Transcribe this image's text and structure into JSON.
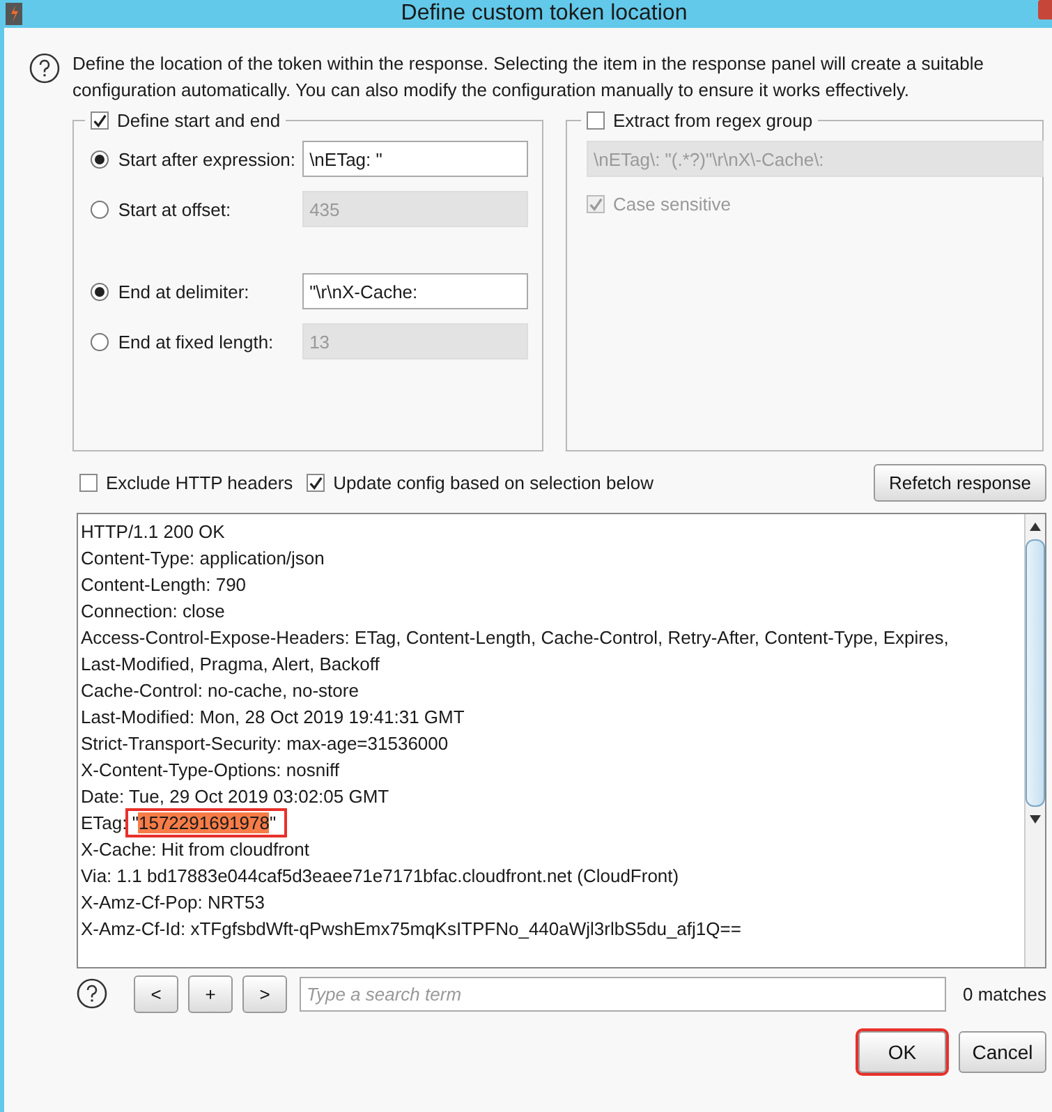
{
  "window": {
    "title": "Define custom token location"
  },
  "description": "Define the location of the token within the response. Selecting the item in the response panel will create a suitable configuration automatically. You can also modify the configuration manually to ensure it works effectively.",
  "start_end_group": {
    "label": "Define start and end",
    "checked": true,
    "options": [
      {
        "label": "Start after expression:",
        "selected": true,
        "value": "\\nETag: \"",
        "disabled": false
      },
      {
        "label": "Start at offset:",
        "selected": false,
        "value": "435",
        "disabled": true
      },
      {
        "label": "End at delimiter:",
        "selected": true,
        "value": "\"\\r\\nX-Cache:",
        "disabled": false
      },
      {
        "label": "End at fixed length:",
        "selected": false,
        "value": "13",
        "disabled": true
      }
    ]
  },
  "regex_group": {
    "label": "Extract from regex group",
    "checked": false,
    "expression": "\\nETag\\: \"(.*?)\"\\r\\nX\\-Cache\\:",
    "case_sensitive": {
      "label": "Case sensitive",
      "checked": true,
      "disabled": true
    }
  },
  "options": [
    {
      "label": "Exclude HTTP headers",
      "checked": false
    },
    {
      "label": "Update config based on selection below",
      "checked": true
    }
  ],
  "refetch_button": "Refetch response",
  "response_lines": [
    {
      "text": "HTTP/1.1 200 OK"
    },
    {
      "text": "Content-Type: application/json"
    },
    {
      "text": "Content-Length: 790"
    },
    {
      "text": "Connection: close"
    },
    {
      "text": "Access-Control-Expose-Headers: ETag, Content-Length, Cache-Control, Retry-After, Content-Type, Expires,"
    },
    {
      "text": "Last-Modified, Pragma, Alert, Backoff"
    },
    {
      "text": "Cache-Control: no-cache, no-store"
    },
    {
      "text": "Last-Modified: Mon, 28 Oct 2019 19:41:31 GMT"
    },
    {
      "text": "Strict-Transport-Security: max-age=31536000"
    },
    {
      "text": "X-Content-Type-Options: nosniff"
    },
    {
      "text": "Date: Tue, 29 Oct 2019 03:02:05 GMT"
    },
    {
      "text": "ETag: \"",
      "selection": "1572291691978",
      "after": "\"",
      "annotated": true
    },
    {
      "text": "X-Cache: Hit from cloudfront"
    },
    {
      "text": "Via: 1.1 bd17883e044caf5d3eaee71e7171bfac.cloudfront.net (CloudFront)"
    },
    {
      "text": "X-Amz-Cf-Pop: NRT53"
    },
    {
      "text": "X-Amz-Cf-Id: xTFgfsbdWft-qPwshEmx75mqKsITPFNo_440aWjl3rlbS5du_afj1Q=="
    }
  ],
  "search": {
    "buttons": [
      "<",
      "+",
      ">"
    ],
    "placeholder": "Type a search term",
    "matches": "0 matches"
  },
  "buttons": [
    {
      "label": "OK",
      "annotated": true
    },
    {
      "label": "Cancel",
      "annotated": false
    }
  ]
}
